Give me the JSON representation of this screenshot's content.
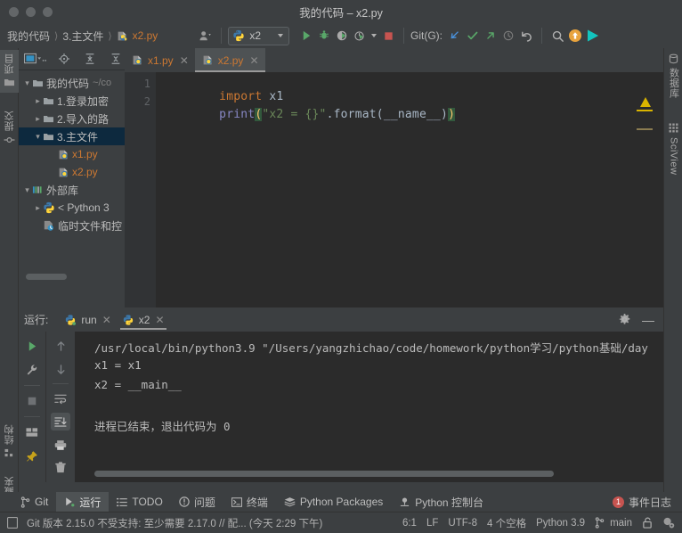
{
  "window": {
    "title": "我的代码 – x2.py"
  },
  "toolbar": {
    "breadcrumbs": [
      "我的代码",
      "3.主文件",
      "x2.py"
    ],
    "run_config": "x2",
    "git_label": "Git(G):",
    "icons": {
      "avatar": "user-avatar-icon",
      "run": "run-icon",
      "debug": "debug-icon",
      "coverage": "run-coverage-icon",
      "profile": "profile-icon",
      "stop": "stop-icon",
      "update": "git-update-icon",
      "commit": "git-commit-icon",
      "push": "git-push-icon",
      "history": "git-history-icon",
      "rollback": "git-rollback-icon",
      "search": "search-icon",
      "plugin": "update-badge-icon",
      "ide": "ide-icon"
    }
  },
  "rail_left": [
    "项目",
    "提交",
    "结构",
    "收藏夹"
  ],
  "rail_right": [
    "数据库",
    "SciView"
  ],
  "project": {
    "tree": [
      {
        "depth": 0,
        "arrow": "down",
        "icon": "folder-icon",
        "label": "我的代码",
        "path": "~/co",
        "selected": false
      },
      {
        "depth": 1,
        "arrow": "right",
        "icon": "folder-icon",
        "label": "1.登录加密",
        "path": "",
        "selected": false
      },
      {
        "depth": 1,
        "arrow": "right",
        "icon": "folder-icon",
        "label": "2.导入的路",
        "path": "",
        "selected": false
      },
      {
        "depth": 1,
        "arrow": "down",
        "icon": "folder-icon",
        "label": "3.主文件",
        "path": "",
        "selected": true
      },
      {
        "depth": 2,
        "arrow": "none",
        "icon": "python-file-icon",
        "label": "x1.py",
        "path": "",
        "selected": false
      },
      {
        "depth": 2,
        "arrow": "none",
        "icon": "python-file-icon",
        "label": "x2.py",
        "path": "",
        "selected": false
      },
      {
        "depth": 0,
        "arrow": "down",
        "icon": "library-icon",
        "label": "外部库",
        "path": "",
        "selected": false
      },
      {
        "depth": 1,
        "arrow": "right",
        "icon": "python-icon",
        "label": "< Python 3",
        "path": "",
        "selected": false
      },
      {
        "depth": 1,
        "arrow": "none",
        "icon": "scratch-icon",
        "label": "临时文件和控",
        "path": "",
        "selected": false
      }
    ]
  },
  "editor": {
    "tabs": [
      {
        "label": "x1.py",
        "active": false
      },
      {
        "label": "x2.py",
        "active": true
      }
    ],
    "line_numbers": [
      "1",
      "2"
    ],
    "line1": {
      "keyword": "import",
      "module": " x1"
    },
    "line2": {
      "fn": "print",
      "paren_open": "(",
      "string": "\"x2 = {}\"",
      "dot_format": ".format",
      "inner_open": "(",
      "arg": "__name__",
      "inner_close": ")",
      "paren_close": ")"
    }
  },
  "run": {
    "title": "运行:",
    "tabs": [
      {
        "label": "run",
        "active": false
      },
      {
        "label": "x2",
        "active": true
      }
    ],
    "console_lines": [
      "/usr/local/bin/python3.9 \"/Users/yangzhichao/code/homework/python学习/python基础/day",
      "x1 = x1",
      "x2 = __main__",
      "",
      "进程已结束，退出代码为 0"
    ],
    "side_icons": [
      "rerun-icon",
      "wrench-icon",
      "stop-icon",
      "layout-icon",
      "pin-icon"
    ],
    "side_icons2": [
      "up-arrow-icon",
      "down-arrow-icon",
      "soft-wrap-icon",
      "scroll-to-end-icon",
      "print-icon",
      "trash-icon"
    ],
    "header_icons": [
      "gear-icon",
      "minimize-icon"
    ]
  },
  "bottom_bar": {
    "items": [
      {
        "label": "Git",
        "icon": "git-branch-icon",
        "active": false
      },
      {
        "label": "运行",
        "icon": "run-icon",
        "active": true
      },
      {
        "label": "TODO",
        "icon": "todo-icon",
        "active": false
      },
      {
        "label": "问题",
        "icon": "problems-icon",
        "active": false
      },
      {
        "label": "终端",
        "icon": "terminal-icon",
        "active": false
      },
      {
        "label": "Python Packages",
        "icon": "packages-icon",
        "active": false
      },
      {
        "label": "Python 控制台",
        "icon": "console-icon",
        "active": false
      }
    ],
    "event_log": {
      "label": "事件日志",
      "count": "1"
    }
  },
  "status_bar": {
    "message": "Git 版本 2.15.0 不受支持: 至少需要 2.17.0 // 配... (今天 2:29 下午)",
    "caret": "6:1",
    "line_sep": "LF",
    "encoding": "UTF-8",
    "indent": "4 个空格",
    "interpreter": "Python 3.9",
    "branch": "main",
    "icons": [
      "memory-icon",
      "lock-icon",
      "inspection-icon"
    ]
  },
  "colors": {
    "accent_orange": "#cc7832",
    "string_green": "#6a8759",
    "function_blue": "#8888c6",
    "warning_yellow": "#d9b400",
    "badge_red": "#c75450",
    "selection_blue": "#0d293e"
  }
}
